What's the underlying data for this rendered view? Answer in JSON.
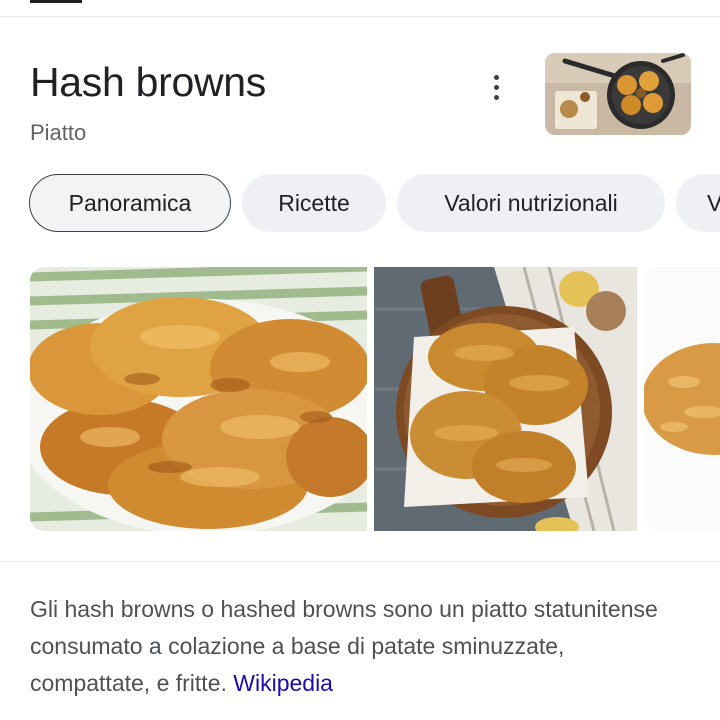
{
  "header": {
    "title": "Hash browns",
    "subtitle": "Piatto"
  },
  "thumbnail": {
    "alt": "Hash browns in padella"
  },
  "tabs": [
    {
      "label": "Panoramica",
      "selected": true
    },
    {
      "label": "Ricette",
      "selected": false
    },
    {
      "label": "Valori nutrizionali",
      "selected": false
    },
    {
      "label": "V",
      "selected": false
    }
  ],
  "gallery": [
    {
      "alt": "Hash browns su un piatto"
    },
    {
      "alt": "Hash browns su un tagliere"
    },
    {
      "alt": "Hash browns"
    }
  ],
  "description": {
    "text": "Gli hash browns o hashed browns sono un piatto statunitense consumato a colazione a base di patate sminuzzate, compattate, e fritte.",
    "source_link": "Wikipedia"
  },
  "colors": {
    "link": "#1a0dab",
    "chip_bg": "#eef0f3",
    "text": "#202124",
    "muted": "#5f6368"
  }
}
